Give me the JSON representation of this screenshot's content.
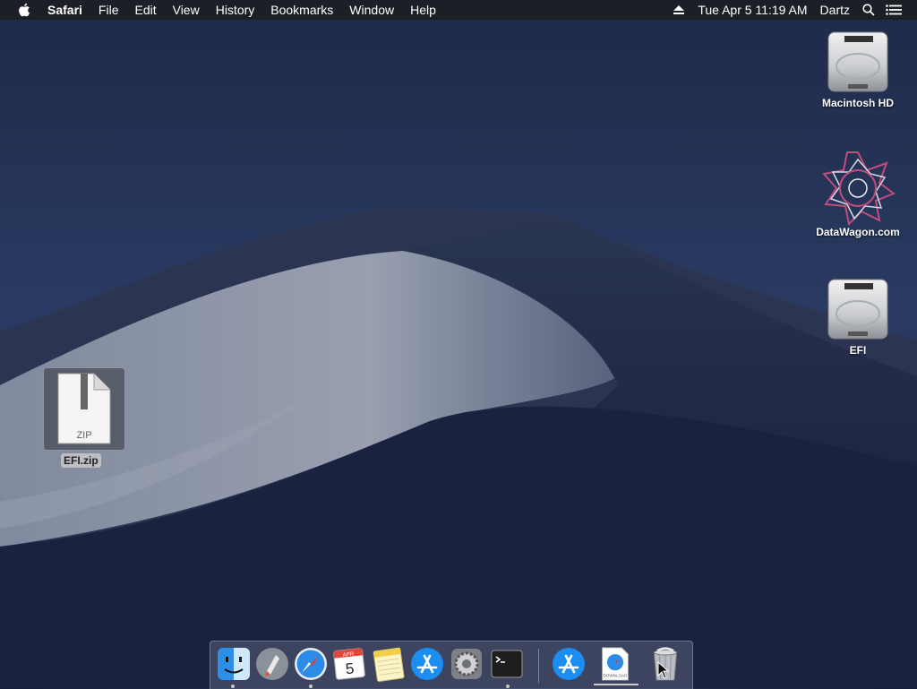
{
  "menubar": {
    "app_name": "Safari",
    "menus": [
      "File",
      "Edit",
      "View",
      "History",
      "Bookmarks",
      "Window",
      "Help"
    ],
    "datetime": "Tue Apr 5  11:19 AM",
    "user": "Dartz"
  },
  "desktop": {
    "icons": [
      {
        "label": "Macintosh HD",
        "icon": "hard-drive-icon"
      },
      {
        "label": "DataWagon.com",
        "icon": "datawagon-logo-icon"
      },
      {
        "label": "EFI",
        "icon": "hard-drive-icon"
      }
    ],
    "selected_file": {
      "label": "EFI.zip",
      "type_text": "ZIP"
    }
  },
  "dock": {
    "calendar_month": "APR",
    "calendar_day": "5",
    "download_text": "DOWNLOAD",
    "items": [
      "finder",
      "launchpad",
      "safari",
      "calendar",
      "notes",
      "app-store",
      "system-preferences",
      "terminal",
      "app-store-download",
      "safari-download",
      "trash"
    ]
  }
}
